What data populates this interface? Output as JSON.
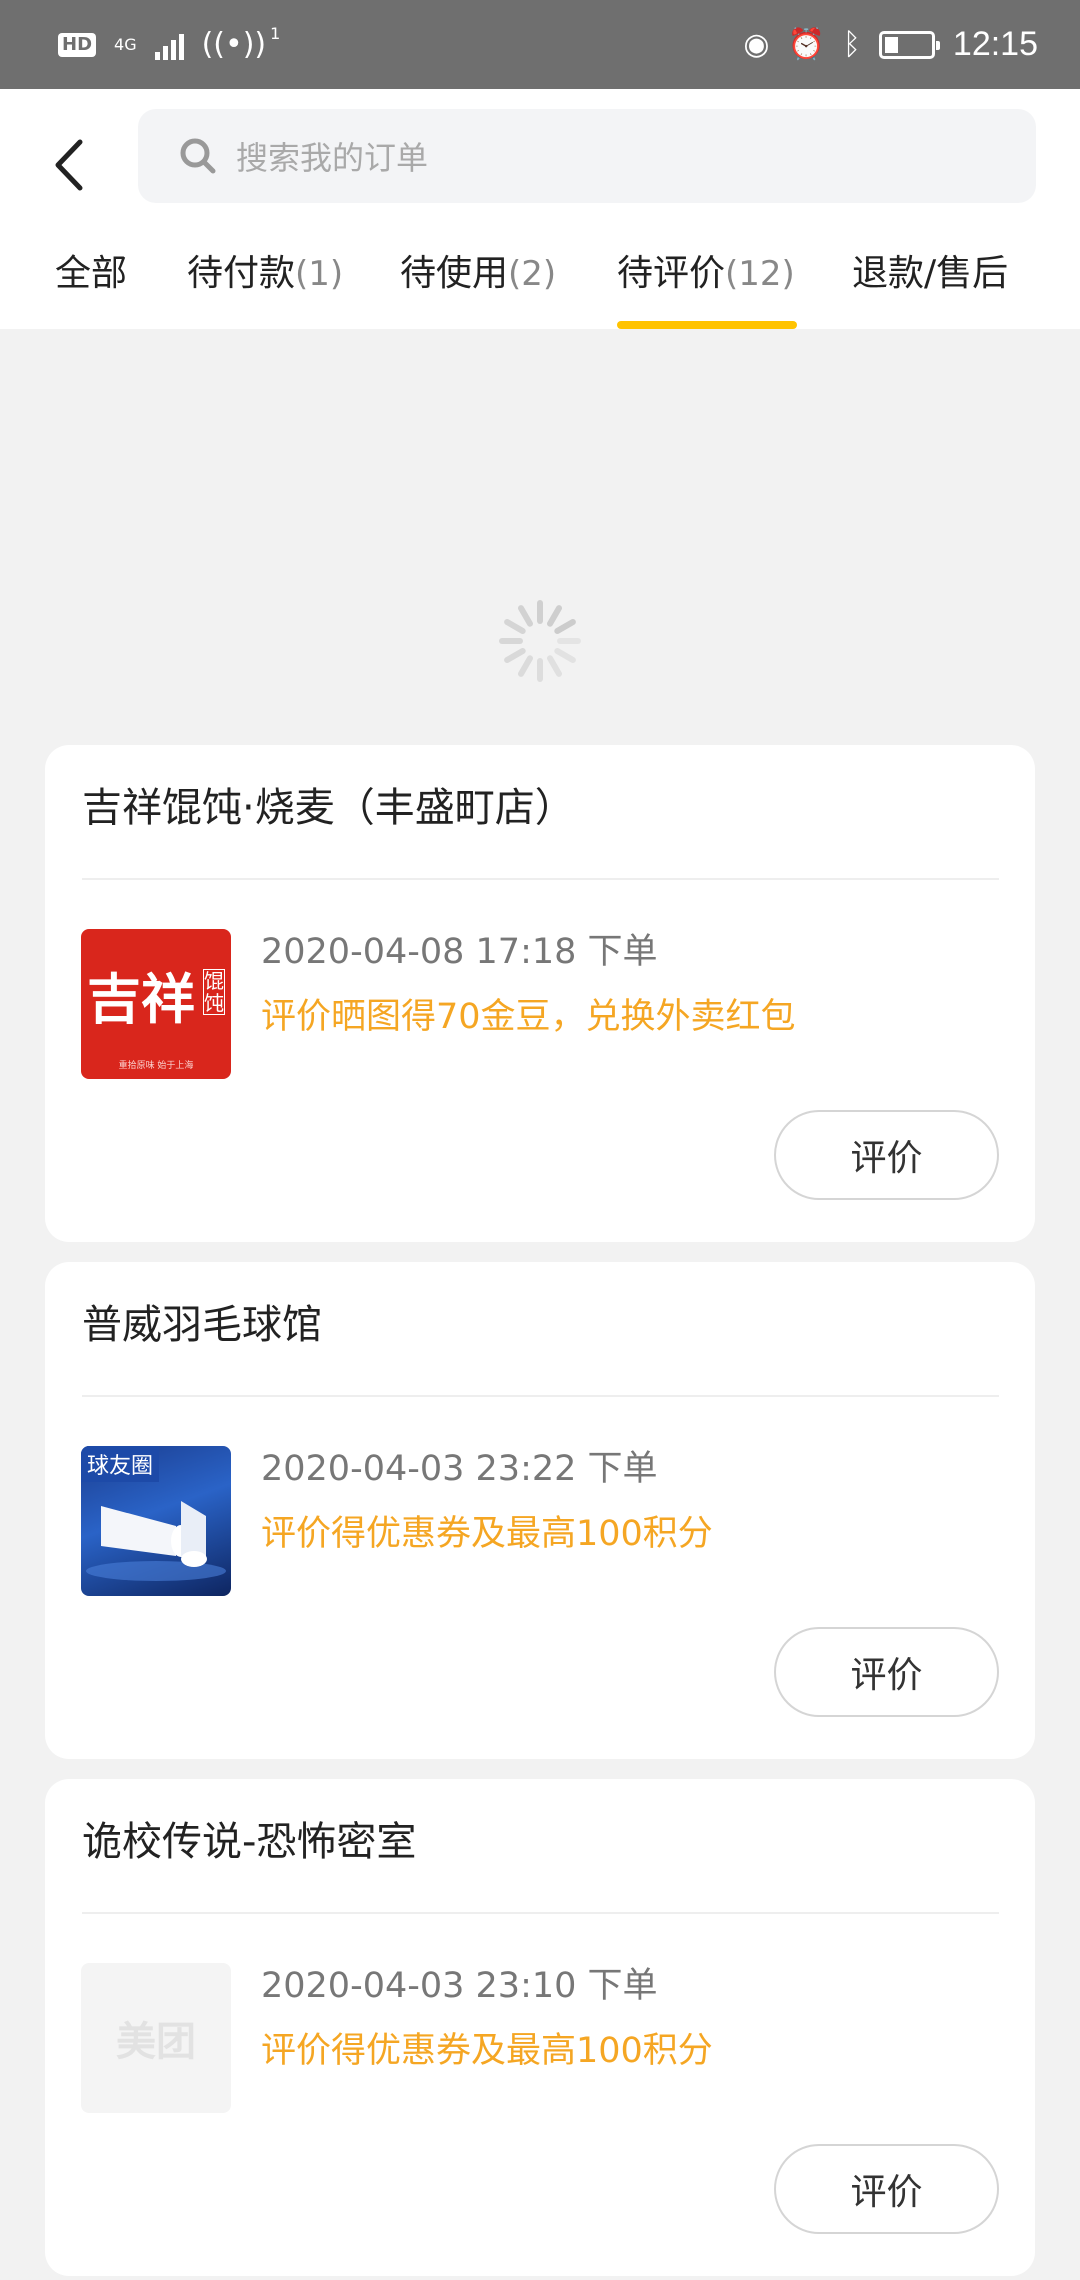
{
  "status_bar": {
    "hd": "HD",
    "net": "4G",
    "sim_index": "1",
    "time": "12:15",
    "icons": [
      "signal-icon",
      "hotspot-icon",
      "eye-icon",
      "alarm-icon",
      "bluetooth-icon",
      "battery-icon"
    ],
    "battery_level": 0.3
  },
  "search": {
    "placeholder": "搜索我的订单"
  },
  "tabs": [
    {
      "label": "全部",
      "count": ""
    },
    {
      "label": "待付款",
      "count": "(1)"
    },
    {
      "label": "待使用",
      "count": "(2)"
    },
    {
      "label": "待评价",
      "count": "(12)"
    },
    {
      "label": "退款/售后",
      "count": ""
    }
  ],
  "active_tab": "待评价",
  "colors": {
    "accent": "#ffc300",
    "promo": "#f5a623",
    "status_bar": "#6f6f6f"
  },
  "orders": [
    {
      "shop": "吉祥馄饨·烧麦（丰盛町店）",
      "time": "2020-04-08 17:18 下单",
      "promo": "评价晒图得70金豆，兑换外卖红包",
      "thumb": {
        "brand": "吉祥",
        "side": "馄饨",
        "tagline": "重拾原味 始于上海"
      },
      "action": "评价"
    },
    {
      "shop": "普威羽毛球馆",
      "time": "2020-04-03 23:22 下单",
      "promo": "评价得优惠券及最高100积分",
      "thumb": {
        "brand": "球友圈"
      },
      "action": "评价"
    },
    {
      "shop": "诡校传说-恐怖密室",
      "time": "2020-04-03 23:10 下单",
      "promo": "评价得优惠券及最高100积分",
      "thumb": {
        "brand": "美团"
      },
      "action": "评价"
    }
  ]
}
